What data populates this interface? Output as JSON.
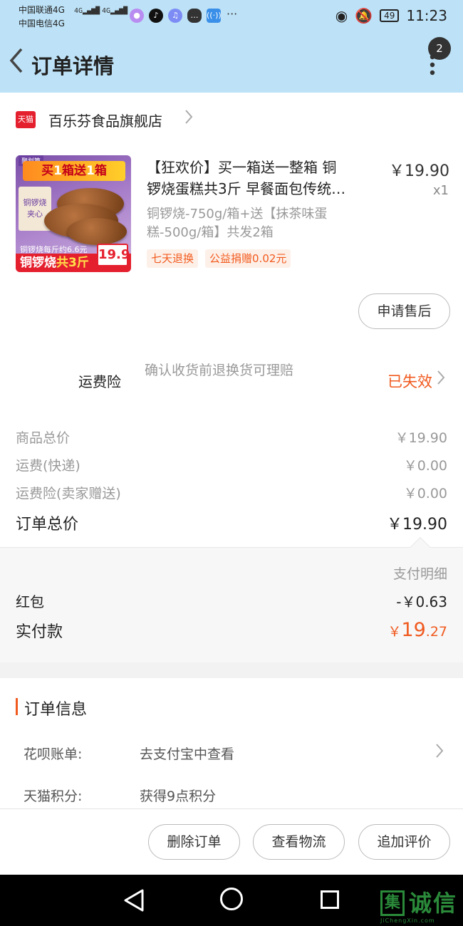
{
  "status_bar": {
    "carrier1": "中国联通4G",
    "carrier2": "中国电信4G",
    "signal_label": "4G",
    "battery": "49",
    "time": "11:23",
    "more": "···"
  },
  "header": {
    "title": "订单详情",
    "badge": "2"
  },
  "shop": {
    "logo_text": "天猫",
    "name": "百乐芬食品旗舰店"
  },
  "product": {
    "title_line1": "【狂欢价】买一箱送一整箱 铜",
    "title_line2": "锣烧蛋糕共3斤 早餐面包传统…",
    "price": "￥19.90",
    "qty": "x1",
    "sku": "铜锣烧-750g/箱+送【抹茶味蛋糕-500g/箱】共发2箱",
    "tags": [
      "七天退换",
      "公益捐赠0.02元"
    ],
    "image": {
      "corner": "聚划算",
      "banner_a": "买",
      "banner_b": "1",
      "banner_c": "箱送",
      "banner_d": "1",
      "banner_e": "箱",
      "box_text": "铜锣烧 夹心",
      "price_note": "铜锣烧每斤约6.6元",
      "bottom_a": "铜锣烧",
      "bottom_b": "共3斤",
      "price_badge": "19.9"
    },
    "after_sale_button": "申请售后"
  },
  "insurance": {
    "label": "运费险",
    "desc": "确认收货前退换货可理赔",
    "status": "已失效"
  },
  "fees": [
    {
      "label": "商品总价",
      "value": "￥19.90"
    },
    {
      "label": "运费(快递)",
      "value": "￥0.00"
    },
    {
      "label": "运费险(卖家赠送)",
      "value": "￥0.00"
    }
  ],
  "total": {
    "label": "订单总价",
    "value": "￥19.90"
  },
  "payment": {
    "detail_link": "支付明细",
    "red_packet_label": "红包",
    "red_packet_value": "-￥0.63",
    "actual_label": "实付款",
    "actual_currency": "￥",
    "actual_int": "19",
    "actual_dec": ".27"
  },
  "order_info": {
    "title": "订单信息",
    "rows": [
      {
        "key": "花呗账单:",
        "value": "去支付宝中查看"
      },
      {
        "key": "天猫积分:",
        "value": "获得9点积分"
      }
    ]
  },
  "actions": {
    "delete": "删除订单",
    "logistics": "查看物流",
    "review": "追加评价"
  },
  "watermark": {
    "logo": "集",
    "text": "诚信",
    "sub": "JiChengXin.com"
  },
  "colors": {
    "header_bg": "#bde2f7",
    "accent": "#f05a1f",
    "tmall_red": "#e5202e"
  }
}
